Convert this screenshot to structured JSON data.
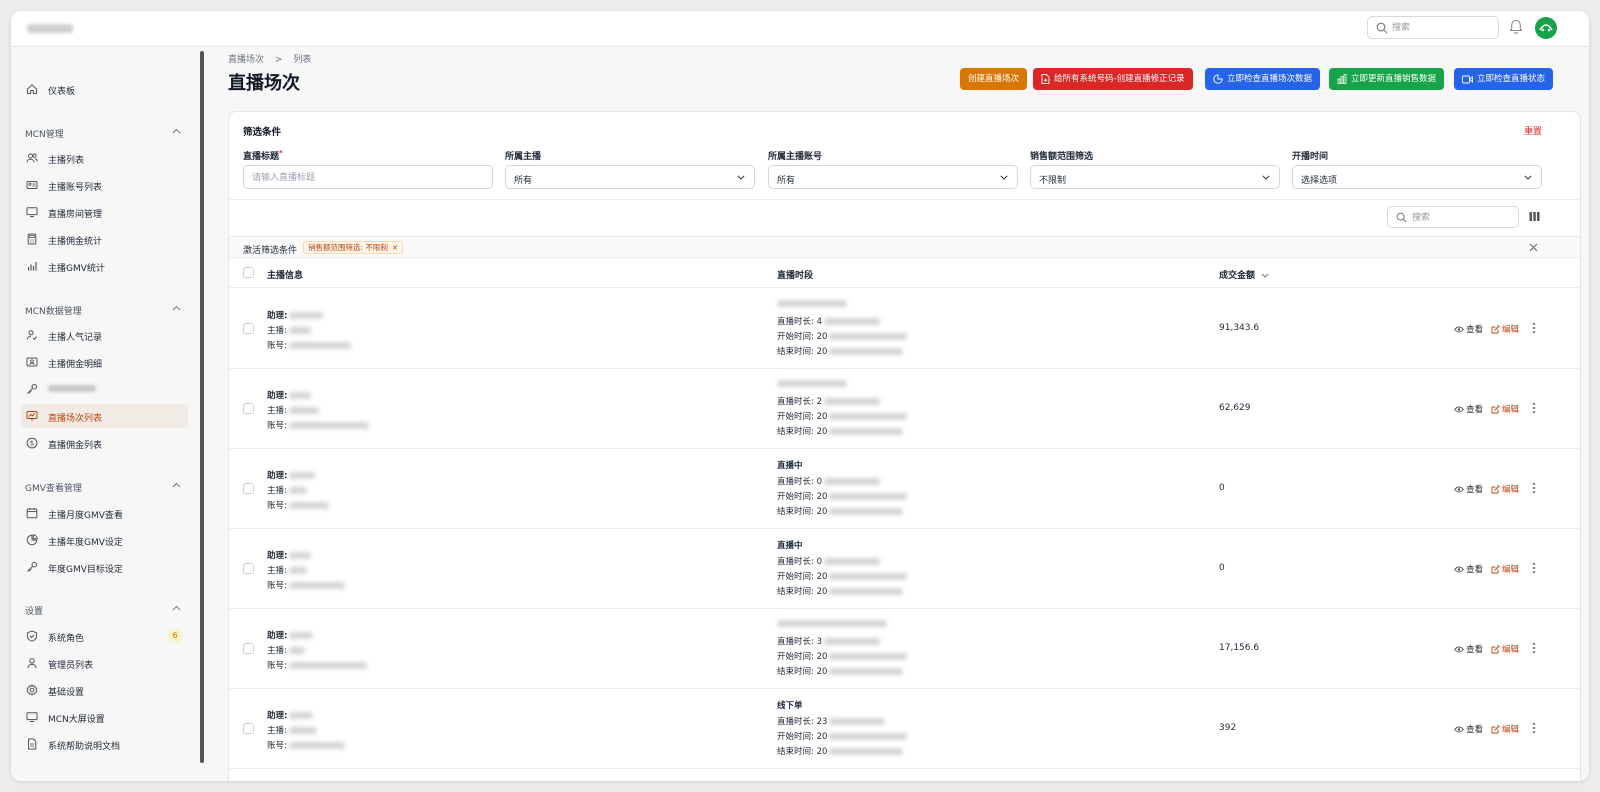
{
  "topbar": {
    "search_placeholder": "搜索"
  },
  "sidebar": {
    "dashboard": "仪表板",
    "groups": [
      {
        "title": "MCN管理",
        "items": [
          "主播列表",
          "主播账号列表",
          "直播房间管理",
          "主播佣金统计",
          "主播GMV统计"
        ]
      },
      {
        "title": "MCN数据管理",
        "items": [
          "主播人气记录",
          "主播佣金明细",
          "",
          "直播场次列表",
          "直播佣金列表"
        ]
      },
      {
        "title": "GMV查看管理",
        "items": [
          "主播月度GMV查看",
          "主播年度GMV设定",
          "年度GMV目标设定"
        ]
      },
      {
        "title": "设置",
        "items": [
          "系统角色",
          "管理员列表",
          "基础设置",
          "MCN大屏设置",
          "系统帮助说明文档"
        ]
      }
    ],
    "role_badge": "6"
  },
  "breadcrumb": [
    "直播场次",
    "列表"
  ],
  "page_title": "直播场次",
  "actions": [
    {
      "label": "创建直播场次",
      "color": "#d97706"
    },
    {
      "label": "给所有系统号码-创建直播修正记录",
      "color": "#dc2626"
    },
    {
      "label": "立即检查直播场次数据",
      "color": "#2563eb"
    },
    {
      "label": "立即更新直播销售数据",
      "color": "#16a34a"
    },
    {
      "label": "立即检查直播状态",
      "color": "#2563eb"
    }
  ],
  "filters": {
    "title": "筛选条件",
    "reset": "重置",
    "fields": [
      {
        "label": "直播标题",
        "required": "*",
        "placeholder": "请输入直播标题"
      },
      {
        "label": "所属主播",
        "value": "所有"
      },
      {
        "label": "所属主播账号",
        "value": "所有"
      },
      {
        "label": "销售额范围筛选",
        "value": "不限制"
      },
      {
        "label": "开播时间",
        "value": "选择选项"
      }
    ]
  },
  "table_search_placeholder": "搜索",
  "active_filters": {
    "label": "激活筛选条件",
    "chip": "销售额范围筛选: 不限制",
    "chip_close": "×"
  },
  "table": {
    "headers": [
      "主播信息",
      "直播时段",
      "成交金额"
    ],
    "info_labels": [
      "助理:",
      "主播:",
      "账号:"
    ],
    "time_labels": [
      "直播时长: ",
      "开始时间: 20",
      "结束时间: 20"
    ],
    "rows": [
      {
        "status": "",
        "duration": "4",
        "amount": "91,343.6"
      },
      {
        "status": "",
        "duration": "2",
        "amount": "62,629"
      },
      {
        "status": "直播中",
        "duration": "0",
        "amount": "0"
      },
      {
        "status": "直播中",
        "duration": "0",
        "amount": "0"
      },
      {
        "status": "",
        "duration": "3",
        "amount": "17,156.6"
      },
      {
        "status": "线下单",
        "duration": "23",
        "amount": "392"
      }
    ],
    "view": "查看",
    "edit": "编辑"
  }
}
